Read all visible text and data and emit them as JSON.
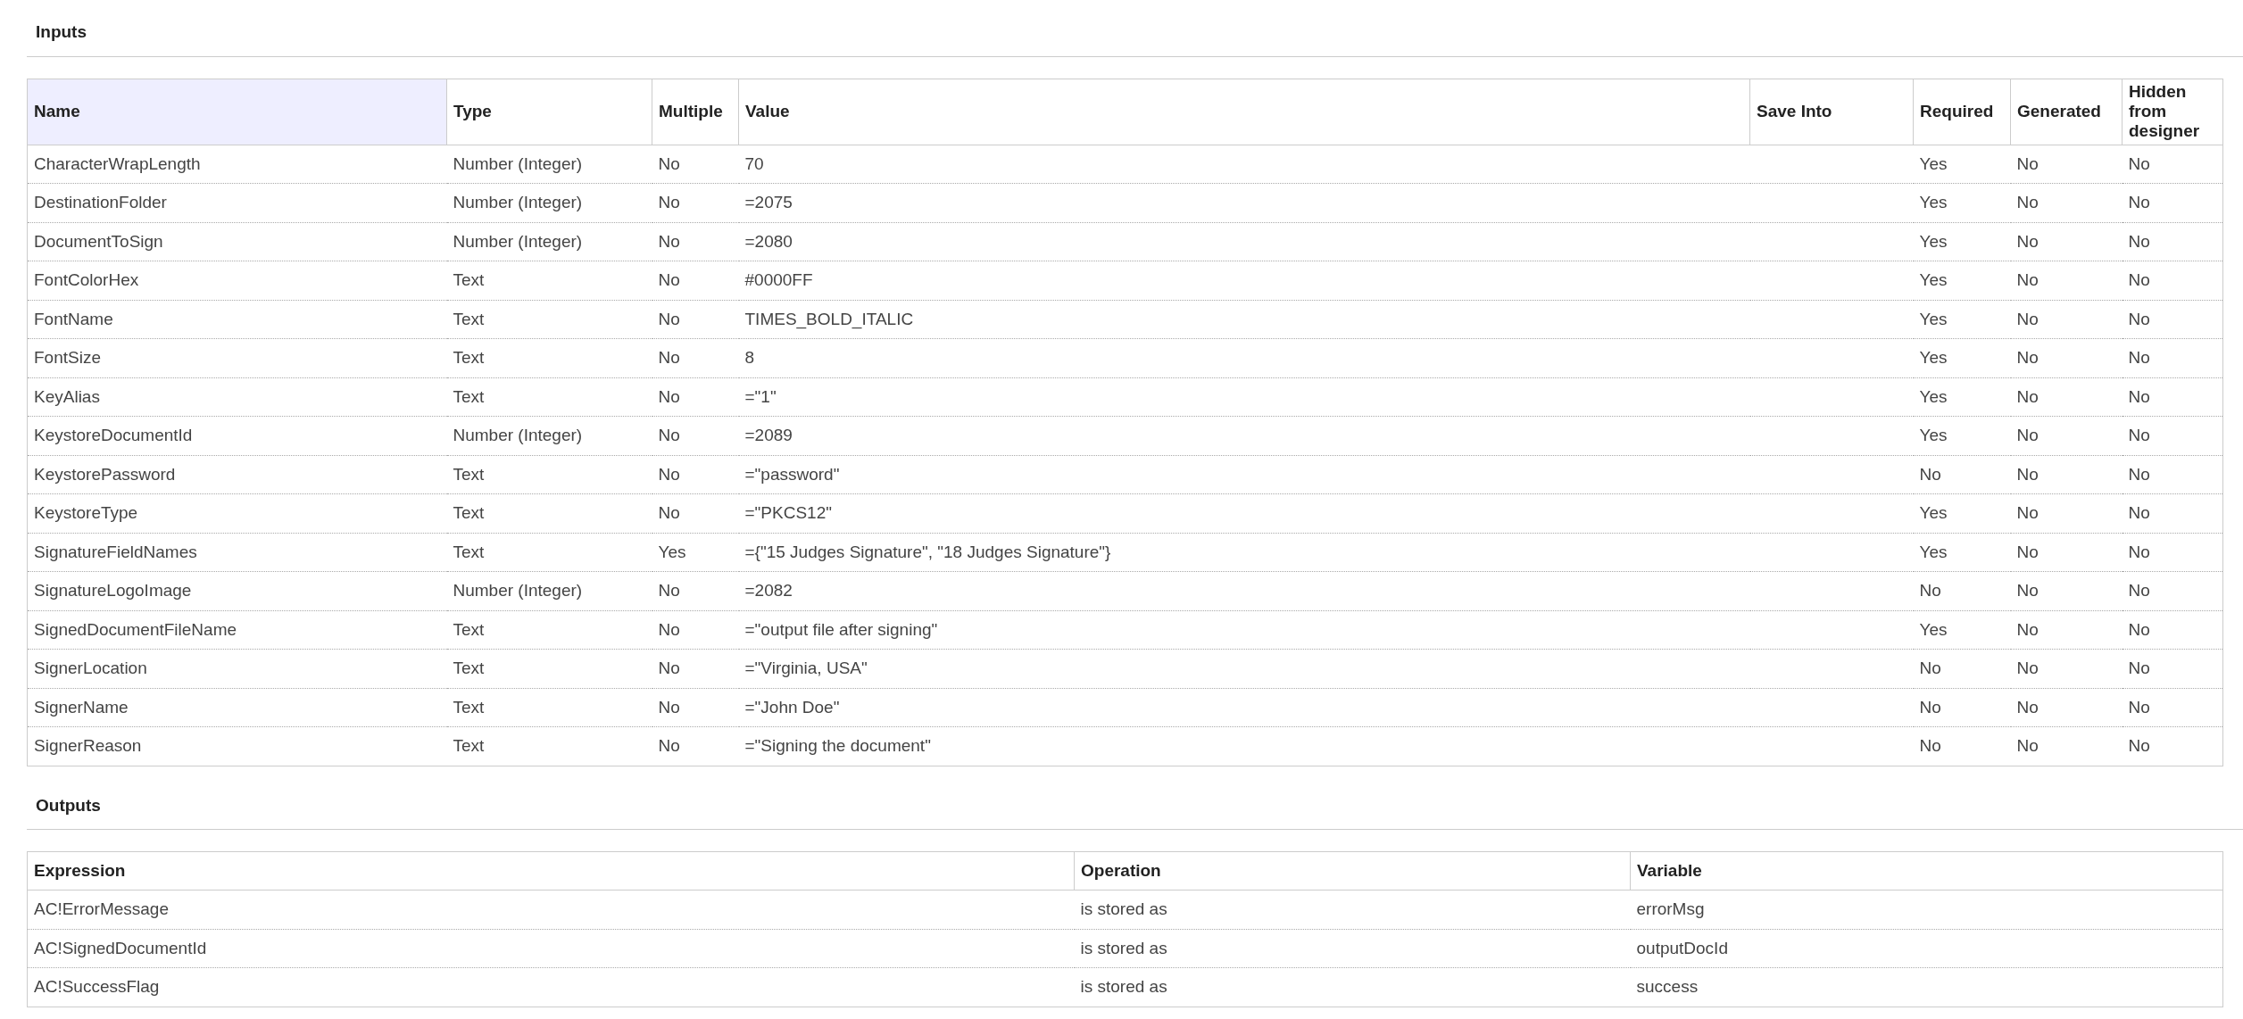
{
  "inputs": {
    "title": "Inputs",
    "columns": [
      {
        "label": "Name",
        "selected": true
      },
      {
        "label": "Type",
        "selected": false
      },
      {
        "label": "Multiple",
        "selected": false
      },
      {
        "label": "Value",
        "selected": false
      },
      {
        "label": "Save Into",
        "selected": false
      },
      {
        "label": "Required",
        "selected": false
      },
      {
        "label": "Generated",
        "selected": false
      },
      {
        "label": "Hidden from designer",
        "selected": false
      }
    ],
    "rows": [
      [
        "CharacterWrapLength",
        "Number (Integer)",
        "No",
        "70",
        "",
        "Yes",
        "No",
        "No"
      ],
      [
        "DestinationFolder",
        "Number (Integer)",
        "No",
        "=2075",
        "",
        "Yes",
        "No",
        "No"
      ],
      [
        "DocumentToSign",
        "Number (Integer)",
        "No",
        "=2080",
        "",
        "Yes",
        "No",
        "No"
      ],
      [
        "FontColorHex",
        "Text",
        "No",
        "#0000FF",
        "",
        "Yes",
        "No",
        "No"
      ],
      [
        "FontName",
        "Text",
        "No",
        "TIMES_BOLD_ITALIC",
        "",
        "Yes",
        "No",
        "No"
      ],
      [
        "FontSize",
        "Text",
        "No",
        "8",
        "",
        "Yes",
        "No",
        "No"
      ],
      [
        "KeyAlias",
        "Text",
        "No",
        "=\"1\"",
        "",
        "Yes",
        "No",
        "No"
      ],
      [
        "KeystoreDocumentId",
        "Number (Integer)",
        "No",
        "=2089",
        "",
        "Yes",
        "No",
        "No"
      ],
      [
        "KeystorePassword",
        "Text",
        "No",
        "=\"password\"",
        "",
        "No",
        "No",
        "No"
      ],
      [
        "KeystoreType",
        "Text",
        "No",
        "=\"PKCS12\"",
        "",
        "Yes",
        "No",
        "No"
      ],
      [
        "SignatureFieldNames",
        "Text",
        "Yes",
        "={\"15 Judges Signature\", \"18 Judges Signature\"}",
        "",
        "Yes",
        "No",
        "No"
      ],
      [
        "SignatureLogoImage",
        "Number (Integer)",
        "No",
        "=2082",
        "",
        "No",
        "No",
        "No"
      ],
      [
        "SignedDocumentFileName",
        "Text",
        "No",
        "=\"output file after signing\"",
        "",
        "Yes",
        "No",
        "No"
      ],
      [
        "SignerLocation",
        "Text",
        "No",
        "=\"Virginia, USA\"",
        "",
        "No",
        "No",
        "No"
      ],
      [
        "SignerName",
        "Text",
        "No",
        "=\"John Doe\"",
        "",
        "No",
        "No",
        "No"
      ],
      [
        "SignerReason",
        "Text",
        "No",
        "=\"Signing the document\"",
        "",
        "No",
        "No",
        "No"
      ]
    ]
  },
  "outputs": {
    "title": "Outputs",
    "columns": [
      {
        "label": "Expression",
        "selected": false
      },
      {
        "label": "Operation",
        "selected": false
      },
      {
        "label": "Variable",
        "selected": false
      }
    ],
    "rows": [
      [
        "AC!ErrorMessage",
        "is stored as",
        "errorMsg"
      ],
      [
        "AC!SignedDocumentId",
        "is stored as",
        "outputDocId"
      ],
      [
        "AC!SuccessFlag",
        "is stored as",
        "success"
      ]
    ]
  }
}
